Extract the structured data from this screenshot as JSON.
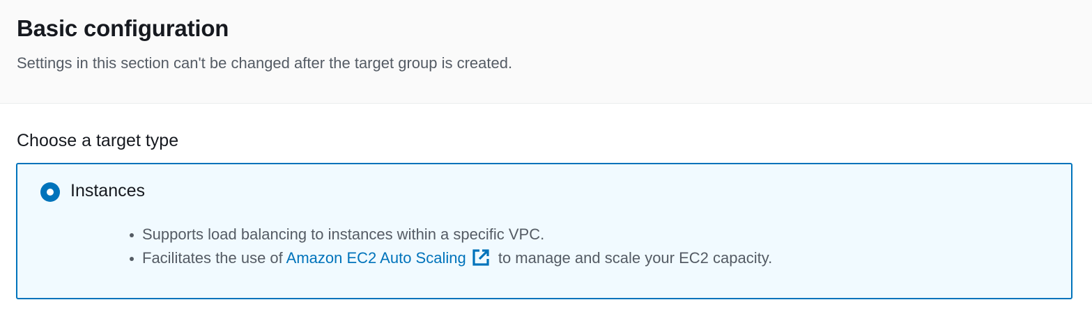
{
  "section": {
    "title": "Basic configuration",
    "description": "Settings in this section can't be changed after the target group is created."
  },
  "target_type": {
    "label": "Choose a target type",
    "selected_option": {
      "label": "Instances",
      "selected": true,
      "bullets": [
        {
          "text": "Supports load balancing to instances within a specific VPC."
        },
        {
          "prefix": "Facilitates the use of ",
          "link_text": "Amazon EC2 Auto Scaling",
          "suffix": " to manage and scale your EC2 capacity."
        }
      ]
    }
  },
  "icons": {
    "radio": "radio-selected-icon",
    "external_link": "external-link-icon"
  },
  "colors": {
    "accent": "#0073bb",
    "tile_background": "#f1faff",
    "header_background": "#fafafa",
    "text_primary": "#16191f",
    "text_secondary": "#545b64"
  }
}
